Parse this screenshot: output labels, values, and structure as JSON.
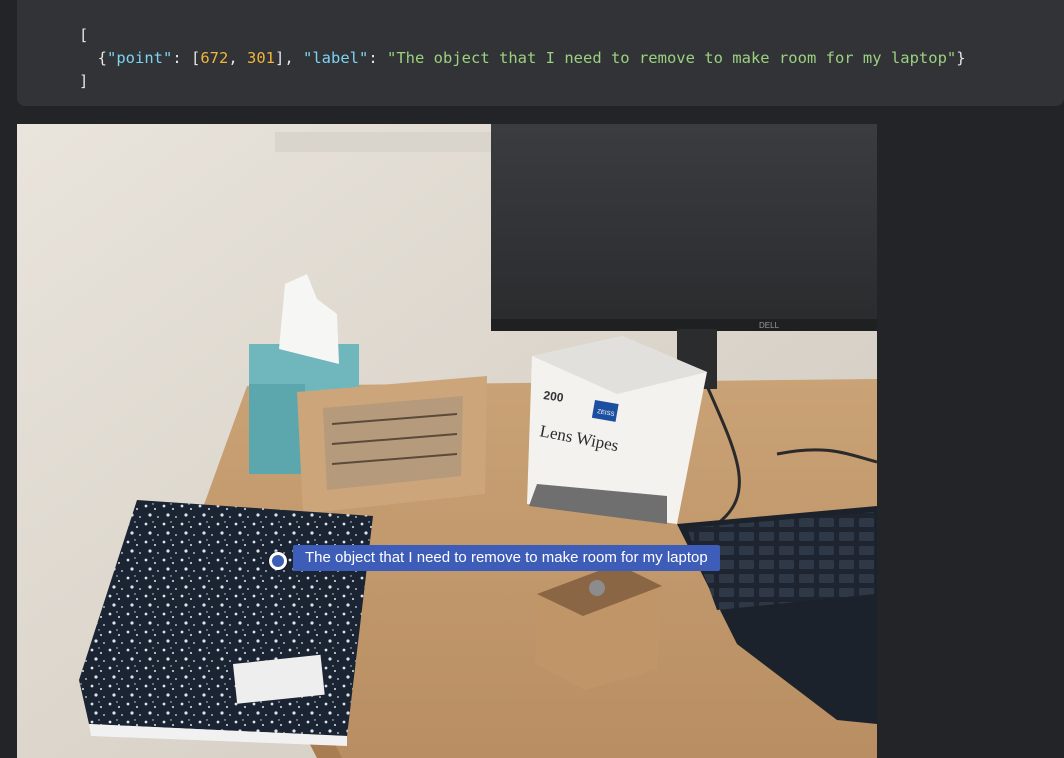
{
  "code": {
    "open_bracket": "[",
    "close_bracket": "]",
    "key_point": "\"point\"",
    "point_x": "672",
    "point_y": "301",
    "key_label": "\"label\"",
    "label_value": "\"The object that I need to remove to make room for my laptop\""
  },
  "annotation": {
    "label": "The object that I need to remove to make room for my laptop"
  },
  "photo": {
    "wipes_count": "200",
    "wipes_brand": "ZEISS",
    "wipes_title": "Lens Wipes",
    "monitor_brand": "DELL"
  }
}
